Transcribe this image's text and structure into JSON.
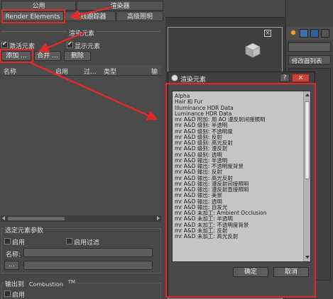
{
  "tabs_top": {
    "public": "公用",
    "renderer": "渲染器"
  },
  "tabs_second": {
    "render_elements": "Render Elements",
    "raytracer": "光线跟踪器",
    "advanced_lighting": "高级照明"
  },
  "section_title": "渲染元素",
  "checkboxes": {
    "activate_elements": "激活元素",
    "display_elements": "显示元素"
  },
  "buttons": {
    "add": "添加 ...",
    "merge": "合并 ...",
    "delete": "删除"
  },
  "columns": [
    "名称",
    "启用",
    "过...",
    "类型",
    "输"
  ],
  "selected_params": {
    "title": "选定元素参数",
    "enable": "启用",
    "enable_filter": "启用过滤",
    "name_label": "名称:",
    "browse_button": "..."
  },
  "output_section": {
    "title": "输出到",
    "combustion": "Combustion",
    "tm": "TM",
    "enable": "启用"
  },
  "right_panel": {
    "modifier_list": "修改器列表"
  },
  "dialog": {
    "title": "渲染元素",
    "help_button": "?",
    "close_button": "×",
    "items": [
      "Alpha",
      "Hair 和 Fur",
      "Illuminance HDR Data",
      "Luminance HDR Data",
      "mr A&D 附加: 用 AO 漫反射间接照明",
      "mr A&D 级别: 半透明",
      "mr A&D 级别: 不透明度",
      "mr A&D 级别: 反射",
      "mr A&D 级别: 高光反射",
      "mr A&D 级别: 漫反射",
      "mr A&D 级别: 透明",
      "mr A&D 输出: 半透明",
      "mr A&D 输出: 不透明度背景",
      "mr A&D 输出: 反射",
      "mr A&D 输出: 高光反射",
      "mr A&D 输出: 漫反射间接照明",
      "mr A&D 输出: 漫反射直接照明",
      "mr A&D 输出: 美景",
      "mr A&D 输出: 透明",
      "mr A&D 输出: 自发光",
      "mr A&D 未加工: Ambient Occlusion",
      "mr A&D 未加工: 半透明",
      "mr A&D 未加工: 不透明度背景",
      "mr A&D 未加工: 反射",
      "mr A&D 未加工: 高光反射"
    ],
    "ok": "确定",
    "cancel": "取消"
  },
  "colors": {
    "annotation_red": "#e02a2a",
    "dialog_bg": "#4a4a4a",
    "list_bg": "#c5c5c5"
  }
}
